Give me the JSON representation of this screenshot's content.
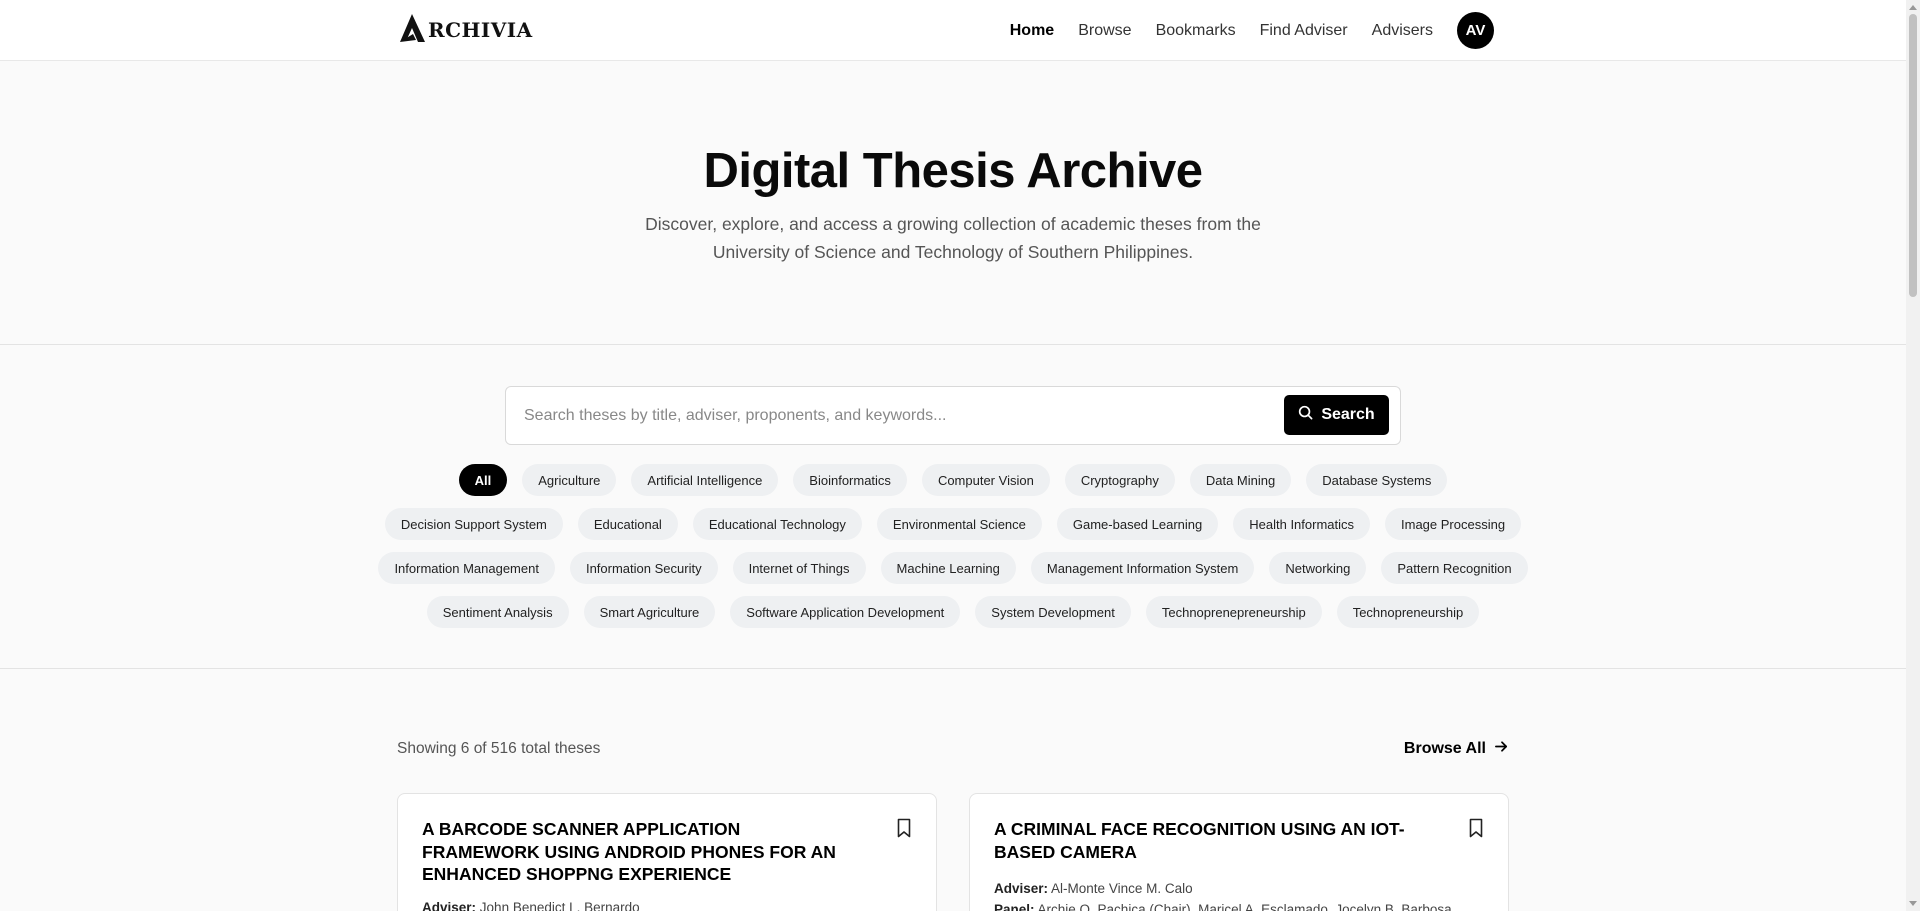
{
  "header": {
    "logo_text": "RCHIVIA",
    "nav": [
      {
        "label": "Home",
        "active": true
      },
      {
        "label": "Browse"
      },
      {
        "label": "Bookmarks"
      },
      {
        "label": "Find Adviser"
      },
      {
        "label": "Advisers"
      }
    ],
    "avatar_initials": "AV"
  },
  "hero": {
    "title": "Digital Thesis Archive",
    "subtitle": "Discover, explore, and access a growing collection of academic theses from the University of Science and Technology of Southern Philippines."
  },
  "search": {
    "placeholder": "Search theses by title, adviser, proponents, and keywords...",
    "value": "",
    "button_label": "Search"
  },
  "tags": {
    "rows": [
      [
        "All",
        "Agriculture",
        "Artificial Intelligence",
        "Bioinformatics",
        "Computer Vision",
        "Cryptography",
        "Data Mining",
        "Database Systems"
      ],
      [
        "Decision Support System",
        "Educational",
        "Educational Technology",
        "Environmental Science",
        "Game-based Learning",
        "Health Informatics",
        "Image Processing"
      ],
      [
        "Information Management",
        "Information Security",
        "Internet of Things",
        "Machine Learning",
        "Management Information System",
        "Networking",
        "Pattern Recognition"
      ],
      [
        "Sentiment Analysis",
        "Smart Agriculture",
        "Software Application Development",
        "System Development",
        "Technoprenepreneurship",
        "Technopreneurship"
      ]
    ],
    "selected": "All"
  },
  "results": {
    "showing_text": "Showing 6 of 516 total theses",
    "browse_all_label": "Browse All",
    "cards": [
      {
        "title": "A BARCODE SCANNER APPLICATION FRAMEWORK USING ANDROID PHONES FOR AN ENHANCED SHOPPNG EXPERIENCE",
        "adviser_label": "Adviser:",
        "adviser": "John Benedict L. Bernardo"
      },
      {
        "title": "A CRIMINAL FACE RECOGNITION USING AN IOT-BASED CAMERA",
        "adviser_label": "Adviser:",
        "adviser": "Al-Monte Vince M. Calo",
        "panel_label": "Panel:",
        "panel": "Archie O. Pachica (Chair), Maricel A. Esclamado, Jocelyn B. Barbosa"
      }
    ]
  },
  "icons": {
    "logo": "archivia-logo-icon",
    "search": "search-icon",
    "arrow": "arrow-right-icon",
    "bookmark": "bookmark-icon"
  }
}
